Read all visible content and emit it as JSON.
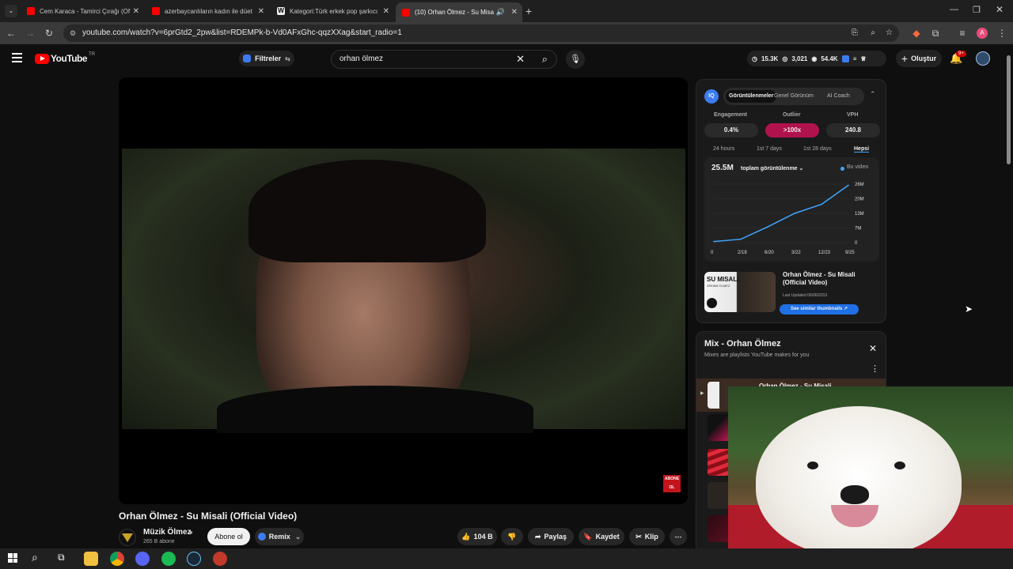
{
  "browser": {
    "tabs": [
      {
        "label": "Cem Karaca - Tamirci Çırağı (Of",
        "active": false
      },
      {
        "label": "azerbaycanlıların kadın ile düet",
        "active": false
      },
      {
        "label": "Kategori:Türk erkek pop şarkıcı",
        "active": false
      },
      {
        "label": "(10) Orhan Ölmez - Su Misa",
        "active": true
      }
    ],
    "url": "youtube.com/watch?v=6prGtd2_2pw&list=RDEMPk-b-Vd0AFxGhc-qqzXXag&start_radio=1",
    "profile_initial": "A"
  },
  "youtube": {
    "logo_text": "YouTube",
    "logo_region": "TR",
    "filter_label": "Filtreler",
    "search_value": "orhan ölmez",
    "stats": {
      "views": "15.3K",
      "subs": "3,021",
      "watch": "54.4K"
    },
    "create_label": "Oluştur",
    "notif_badge": "9+"
  },
  "video": {
    "title": "Orhan Ölmez - Su Misali (Official Video)",
    "channel": "Müzik Ölmez",
    "subscribers": "265 B abone",
    "subscribe_label": "Abone ol",
    "remix_label": "Remix",
    "likes": "104 B",
    "share_label": "Paylaş",
    "save_label": "Kaydet",
    "clip_label": "Klip",
    "watermark": "ABONE OL"
  },
  "vidiq": {
    "tabs": [
      "Görüntülenmeler",
      "Genel Görünüm",
      "AI Coach"
    ],
    "metrics": [
      {
        "label": "Engagement",
        "value": "0.4%"
      },
      {
        "label": "Outlier",
        "value": ">100x"
      },
      {
        "label": "VPH",
        "value": "240.8"
      }
    ],
    "ranges": [
      "24 hours",
      "1st 7 days",
      "1st 28 days",
      "Hepsi"
    ],
    "total": "25.5M",
    "dropdown": "toplam görüntülenme",
    "legend": "Bu video",
    "thumb_title": "Orhan Ölmez - Su Misali (Official Video)",
    "thumb_updated": "Last Updated 06/06/2013",
    "similar_label": "See similar thumbnails",
    "thumb_text": "SU MISALI",
    "thumb_sub": "ORHAN ÖLMEZ"
  },
  "chart_data": {
    "type": "line",
    "x": [
      "0",
      "2/18",
      "6/20",
      "3/22",
      "12/23",
      "9/25"
    ],
    "y_ticks": [
      "0",
      "7M",
      "13M",
      "20M",
      "26M"
    ],
    "series": [
      {
        "name": "Bu video",
        "values": [
          0.5,
          1.5,
          7,
          13,
          17,
          25.5
        ]
      }
    ],
    "ylim": [
      0,
      26
    ],
    "color": "#3ea6ff"
  },
  "mix": {
    "title": "Mix - Orhan Ölmez",
    "subtitle": "Mixes are playlists YouTube makes for you",
    "first_item": "Orhan Ölmez - Su Misali"
  }
}
